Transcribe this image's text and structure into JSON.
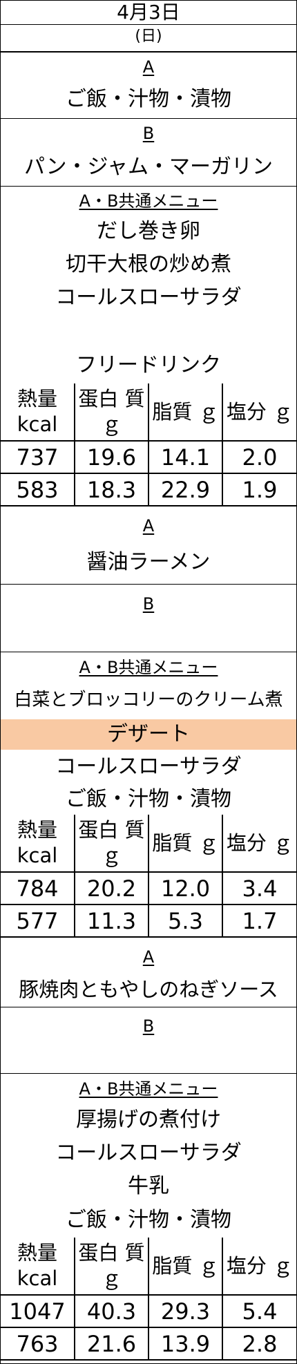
{
  "header": {
    "date": "4月3日",
    "weekday": "(日)"
  },
  "nutrition_headers": [
    "熱量 kcal",
    "蛋白 質ｇ",
    "脂質 ｇ",
    "塩分 ｇ"
  ],
  "meals": [
    {
      "a_label": "A",
      "a_items": [
        "ご飯・汁物・漬物"
      ],
      "b_label": "B",
      "b_items": [
        "パン・ジャム・マーガリン"
      ],
      "common_label": "A・B共通メニュー",
      "common_items": [
        "だし巻き卵",
        "切干大根の炒め煮",
        "コールスローサラダ",
        "",
        "フリードリンク"
      ],
      "nutrition": [
        [
          "737",
          "19.6",
          "14.1",
          "2.0"
        ],
        [
          "583",
          "18.3",
          "22.9",
          "1.9"
        ]
      ]
    },
    {
      "a_label": "A",
      "a_items": [
        "醤油ラーメン"
      ],
      "b_label": "B",
      "b_items": [],
      "common_label": "A・B共通メニュー",
      "common_items": [
        "白菜とブロッコリーのクリーム煮",
        "デザート",
        "コールスローサラダ",
        "ご飯・汁物・漬物"
      ],
      "highlight_item": "デザート",
      "highlight_color": "#f9c9a3",
      "nutrition": [
        [
          "784",
          "20.2",
          "12.0",
          "3.4"
        ],
        [
          "577",
          "11.3",
          "5.3",
          "1.7"
        ]
      ]
    },
    {
      "a_label": "A",
      "a_items": [
        "豚焼肉ともやしのねぎソース"
      ],
      "b_label": "B",
      "b_items": [],
      "common_label": "A・B共通メニュー",
      "common_items": [
        "厚揚げの煮付け",
        "コールスローサラダ",
        "牛乳",
        "ご飯・汁物・漬物"
      ],
      "nutrition": [
        [
          "1047",
          "40.3",
          "29.3",
          "5.4"
        ],
        [
          "763",
          "21.6",
          "13.9",
          "2.8"
        ]
      ]
    }
  ]
}
